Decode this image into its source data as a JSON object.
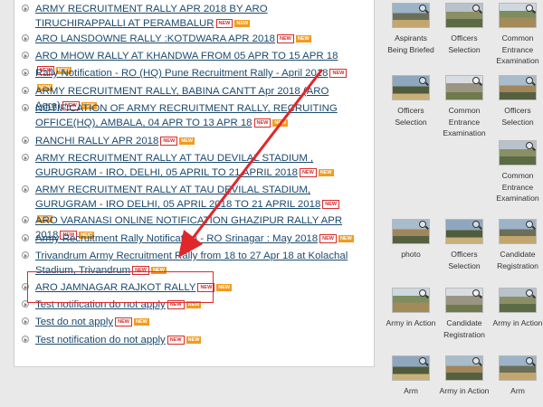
{
  "links": [
    {
      "text": "ARMY RECRUITMENT RALLY APR 2018 BY ARO TIRUCHIRAPPALLI AT PERAMBALUR"
    },
    {
      "text": "ARO LANSDOWNE RALLY :KOTDWARA APR 2018"
    },
    {
      "text": "ARO MHOW RALLY AT KHANDWA FROM 05 APR TO 15 APR 18"
    },
    {
      "text": "Rally Notification - RO (HQ) Pune Recruitment Rally - April 2018"
    },
    {
      "text": "ARMY RECRUITMENT RALLY, BABINA CANTT Apr 2018 (ARO Agra)"
    },
    {
      "text": "NOTIFICATION OF ARMY RECRUITMENT RALLY, RECRUITING OFFICE(HQ), AMBALA, 04 APR TO 13 APR 18"
    },
    {
      "text": "RANCHI RALLY APR 2018"
    },
    {
      "text": "ARMY RECRUITMENT RALLY AT TAU DEVILAL STADIUM , GURUGRAM - IRO, DELHI, 05 APRIL TO 21 APRIL 2018"
    },
    {
      "text": "ARMY RECRUITMENT RALLY AT TAU DEVILAL STADIUM, GURUGRAM - IRO DELHI, 05 APRIL 2018 TO 21 APRIL 2018"
    },
    {
      "text": "ARO VARANASI ONLINE NOTIFICATION GHAZIPUR RALLY APR 2018"
    },
    {
      "text": "Army Recruitment Rally Notification - RO Srinagar : May 2018"
    },
    {
      "text": "Trivandrum Army Recruitment Rally from 18 to 27 Apr 18 at Kolachal Stadium, Trivandrum"
    },
    {
      "text": "ARO JAMNAGAR RAJKOT RALLY"
    },
    {
      "text": "Test notification do not apply"
    },
    {
      "text": "Test do not apply"
    },
    {
      "text": "Test notification do not apply"
    }
  ],
  "badges": {
    "new_a": "NEW",
    "new_b": "NEW"
  },
  "gallery": [
    {
      "caption": "Aspirants Being Briefed"
    },
    {
      "caption": "Officers Selection"
    },
    {
      "caption": "Common Entrance Examination"
    },
    {
      "caption": "Officers Selection"
    },
    {
      "caption": "Common Entrance Examination"
    },
    {
      "caption": "Officers Selection"
    },
    {
      "caption": "Common Entrance Examination"
    },
    {
      "caption": "photo"
    },
    {
      "caption": "Officers Selection"
    },
    {
      "caption": "Candidate Registration"
    },
    {
      "caption": "Army in Action"
    },
    {
      "caption": "Candidate Registration"
    },
    {
      "caption": "Army in Action"
    },
    {
      "caption": "Arm"
    },
    {
      "caption": "Army in Action"
    },
    {
      "caption": "Arm"
    }
  ],
  "colors": {
    "link": "#1c4a6e",
    "highlight": "#e0272b",
    "badge_orange": "#f29b1d"
  }
}
